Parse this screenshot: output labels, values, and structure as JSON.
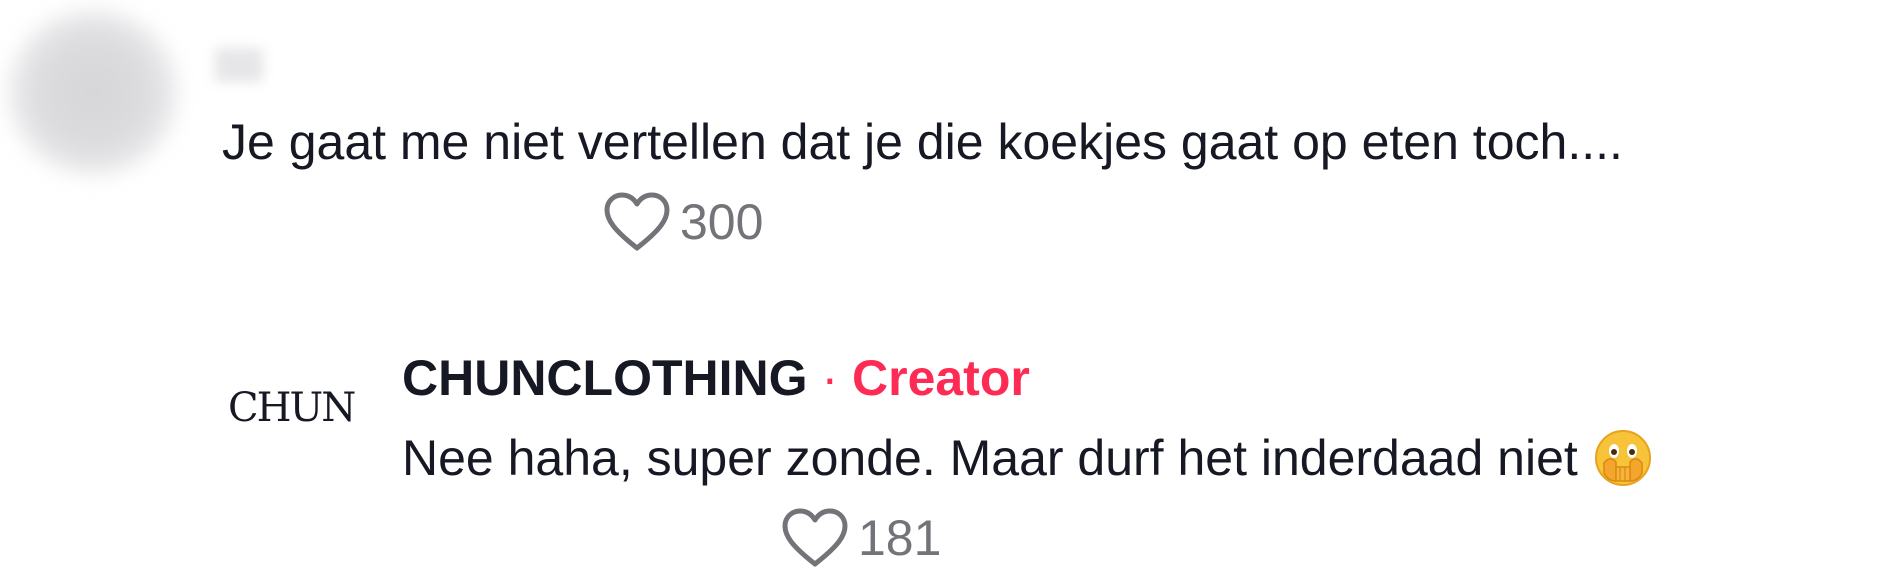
{
  "comment": {
    "text": "Je gaat me niet vertellen dat je die koekjes gaat op eten toch....",
    "likes": "300",
    "icon": "heart-outline-icon"
  },
  "reply": {
    "avatar_text": "CHUN",
    "username": "CHUNCLOTHING",
    "separator": "·",
    "role": "Creator",
    "text": "Nee haha, super zonde. Maar durf het inderdaad niet",
    "emoji": "face-with-open-eyes-and-hand-over-mouth-icon",
    "likes": "181",
    "icon": "heart-outline-icon"
  },
  "colors": {
    "text": "#161823",
    "secondary": "#737479",
    "creator_accent": "#fe2c55"
  }
}
